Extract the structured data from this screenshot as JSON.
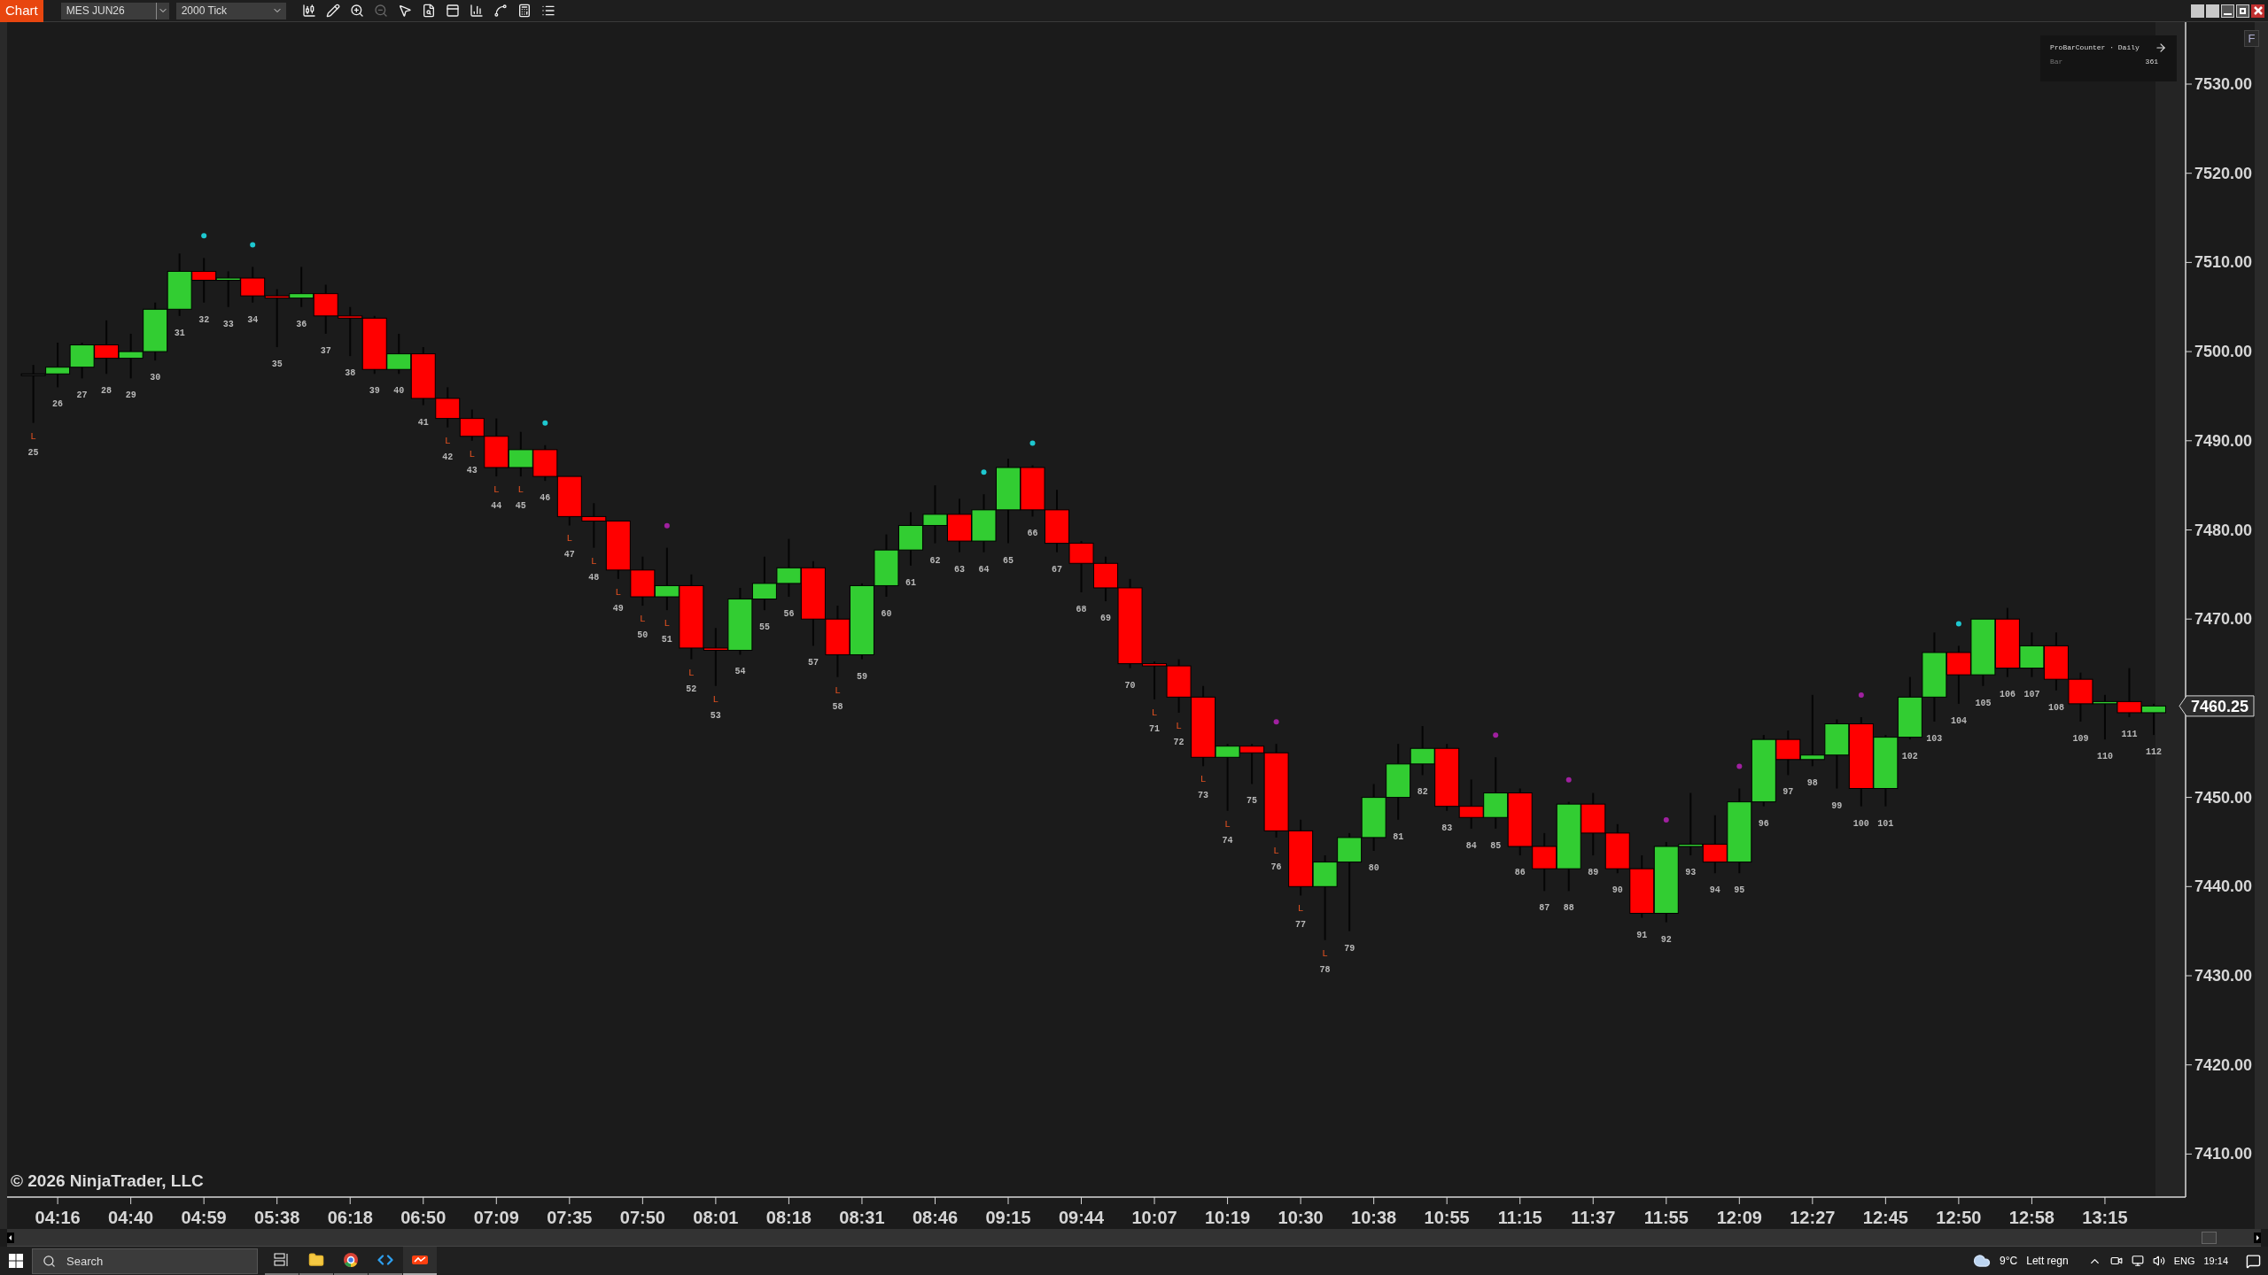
{
  "toolbar": {
    "chart_button": "Chart",
    "instrument": "MES JUN26",
    "interval": "2000 Tick",
    "tools": [
      {
        "kind": "candles",
        "disabled": false
      },
      {
        "kind": "draw",
        "disabled": false
      },
      {
        "kind": "zoom-in",
        "disabled": false
      },
      {
        "kind": "zoom-out",
        "disabled": true
      },
      {
        "kind": "select",
        "disabled": false
      },
      {
        "kind": "data-box",
        "disabled": false
      },
      {
        "kind": "panels",
        "disabled": false
      },
      {
        "kind": "frame",
        "disabled": false
      },
      {
        "kind": "strategy",
        "disabled": false
      },
      {
        "kind": "properties",
        "disabled": false
      },
      {
        "kind": "list",
        "disabled": false
      }
    ]
  },
  "indicator": {
    "title": "ProBarCounter · Daily",
    "label": "Bar",
    "value": "361"
  },
  "scale_button": "F",
  "chart": {
    "copyright": "© 2026 NinjaTrader, LLC",
    "price_labels": [
      {
        "kind": "tick",
        "text": "7530.00"
      },
      {
        "kind": "tick",
        "text": "7520.00"
      },
      {
        "kind": "tick",
        "text": "7510.00"
      },
      {
        "kind": "tick",
        "text": "7500.00"
      },
      {
        "kind": "tick",
        "text": "7490.00"
      },
      {
        "kind": "tick",
        "text": "7480.00"
      },
      {
        "kind": "tick",
        "text": "7470.00"
      },
      {
        "kind": "last",
        "text": "7460.25"
      },
      {
        "kind": "tick",
        "text": "7450.00"
      },
      {
        "kind": "tick",
        "text": "7440.00"
      },
      {
        "kind": "tick",
        "text": "7430.00"
      },
      {
        "kind": "tick",
        "text": "7420.00"
      },
      {
        "kind": "tick",
        "text": "7410.00"
      }
    ],
    "time_labels": [
      "04:16",
      "04:40",
      "04:59",
      "05:38",
      "06:18",
      "06:50",
      "07:09",
      "07:35",
      "07:50",
      "08:01",
      "08:18",
      "08:31",
      "08:46",
      "09:15",
      "09:44",
      "10:07",
      "10:19",
      "10:30",
      "10:38",
      "10:55",
      "11:15",
      "11:37",
      "11:55",
      "12:09",
      "12:27",
      "12:45",
      "12:50",
      "12:58",
      "13:15"
    ],
    "candles": [
      {
        "label": "25",
        "kind": "flat",
        "marker": "L"
      },
      {
        "label": "26",
        "kind": "up"
      },
      {
        "label": "27",
        "kind": "up"
      },
      {
        "label": "28",
        "kind": "down"
      },
      {
        "label": "29",
        "kind": "up"
      },
      {
        "label": "30",
        "kind": "up"
      },
      {
        "label": "31",
        "kind": "up"
      },
      {
        "label": "32",
        "kind": "down",
        "color": "#1ec8d0"
      },
      {
        "label": "33",
        "kind": "up"
      },
      {
        "label": "34",
        "kind": "down",
        "color": "#1ec8d0"
      },
      {
        "label": "35",
        "kind": "down"
      },
      {
        "label": "36",
        "kind": "up"
      },
      {
        "label": "37",
        "kind": "down"
      },
      {
        "label": "38",
        "kind": "down"
      },
      {
        "label": "39",
        "kind": "down"
      },
      {
        "label": "40",
        "kind": "up"
      },
      {
        "label": "41",
        "kind": "down"
      },
      {
        "label": "42",
        "kind": "down",
        "marker": "L"
      },
      {
        "label": "43",
        "kind": "down",
        "marker": "L"
      },
      {
        "label": "44",
        "kind": "down",
        "marker": "L"
      },
      {
        "label": "45",
        "kind": "up",
        "marker": "L"
      },
      {
        "label": "46",
        "kind": "down",
        "color": "#1ec8d0"
      },
      {
        "label": "47",
        "kind": "down",
        "marker": "L"
      },
      {
        "label": "48",
        "kind": "down",
        "marker": "L"
      },
      {
        "label": "49",
        "kind": "down",
        "marker": "L"
      },
      {
        "label": "50",
        "kind": "down",
        "marker": "L"
      },
      {
        "label": "51",
        "kind": "up",
        "marker": "L",
        "color": "#a020a0"
      },
      {
        "label": "52",
        "kind": "down",
        "marker": "L"
      },
      {
        "label": "53",
        "kind": "down",
        "marker": "L"
      },
      {
        "label": "54",
        "kind": "up"
      },
      {
        "label": "55",
        "kind": "up"
      },
      {
        "label": "56",
        "kind": "up"
      },
      {
        "label": "57",
        "kind": "down"
      },
      {
        "label": "58",
        "kind": "down",
        "marker": "L"
      },
      {
        "label": "59",
        "kind": "up"
      },
      {
        "label": "60",
        "kind": "up"
      },
      {
        "label": "61",
        "kind": "up"
      },
      {
        "label": "62",
        "kind": "up"
      },
      {
        "label": "63",
        "kind": "down"
      },
      {
        "label": "64",
        "kind": "up",
        "color": "#1ec8d0"
      },
      {
        "label": "65",
        "kind": "up"
      },
      {
        "label": "66",
        "kind": "down",
        "color": "#1ec8d0"
      },
      {
        "label": "67",
        "kind": "down"
      },
      {
        "label": "68",
        "kind": "down"
      },
      {
        "label": "69",
        "kind": "down"
      },
      {
        "label": "70",
        "kind": "down"
      },
      {
        "label": "71",
        "kind": "down",
        "marker": "L"
      },
      {
        "label": "72",
        "kind": "down",
        "marker": "L"
      },
      {
        "label": "73",
        "kind": "down",
        "marker": "L"
      },
      {
        "label": "74",
        "kind": "up",
        "marker": "L"
      },
      {
        "label": "75",
        "kind": "down"
      },
      {
        "label": "76",
        "kind": "down",
        "marker": "L",
        "color": "#a020a0"
      },
      {
        "label": "77",
        "kind": "down",
        "marker": "L"
      },
      {
        "label": "78",
        "kind": "up",
        "marker": "L"
      },
      {
        "label": "79",
        "kind": "up"
      },
      {
        "label": "80",
        "kind": "up"
      },
      {
        "label": "81",
        "kind": "up"
      },
      {
        "label": "82",
        "kind": "up"
      },
      {
        "label": "83",
        "kind": "down"
      },
      {
        "label": "84",
        "kind": "down"
      },
      {
        "label": "85",
        "kind": "up",
        "color": "#a020a0"
      },
      {
        "label": "86",
        "kind": "down"
      },
      {
        "label": "87",
        "kind": "down"
      },
      {
        "label": "88",
        "kind": "up",
        "color": "#a020a0"
      },
      {
        "label": "89",
        "kind": "down"
      },
      {
        "label": "90",
        "kind": "down"
      },
      {
        "label": "91",
        "kind": "down"
      },
      {
        "label": "92",
        "kind": "up",
        "color": "#a020a0"
      },
      {
        "label": "93",
        "kind": "up"
      },
      {
        "label": "94",
        "kind": "down"
      },
      {
        "label": "95",
        "kind": "up",
        "color": "#a020a0"
      },
      {
        "label": "96",
        "kind": "up"
      },
      {
        "label": "97",
        "kind": "down"
      },
      {
        "label": "98",
        "kind": "up"
      },
      {
        "label": "99",
        "kind": "up"
      },
      {
        "label": "100",
        "kind": "down",
        "color": "#a020a0"
      },
      {
        "label": "101",
        "kind": "up"
      },
      {
        "label": "102",
        "kind": "up"
      },
      {
        "label": "103",
        "kind": "up"
      },
      {
        "label": "104",
        "kind": "down",
        "color": "#1ec8d0"
      },
      {
        "label": "105",
        "kind": "up"
      },
      {
        "label": "106",
        "kind": "down"
      },
      {
        "label": "107",
        "kind": "up"
      },
      {
        "label": "108",
        "kind": "down"
      },
      {
        "label": "109",
        "kind": "down"
      },
      {
        "label": "110",
        "kind": "up"
      },
      {
        "label": "111",
        "kind": "down"
      },
      {
        "label": "112",
        "kind": "up"
      }
    ]
  },
  "taskbar": {
    "search_placeholder": "Search",
    "apps": [
      {
        "kind": "task-view",
        "selected": false
      },
      {
        "kind": "files",
        "selected": false
      },
      {
        "kind": "browser",
        "selected": false
      },
      {
        "kind": "editor",
        "selected": false
      },
      {
        "kind": "trading",
        "selected": true
      }
    ],
    "temperature": "9°C",
    "weather": "Lett regn",
    "language": "ENG",
    "time": "19:14"
  }
}
